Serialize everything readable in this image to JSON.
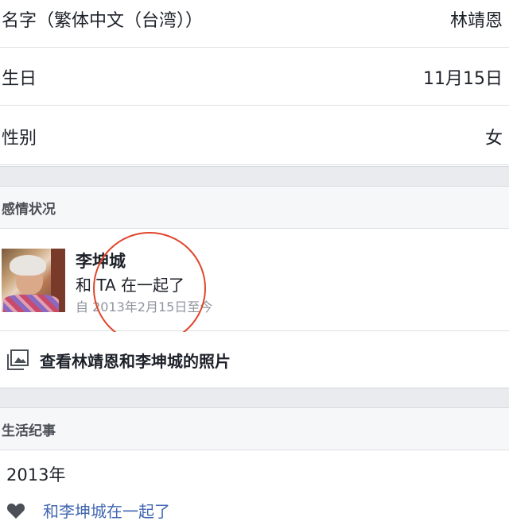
{
  "profile": {
    "rows": [
      {
        "label": "名字（繁体中文（台湾））",
        "value": "林靖恩"
      },
      {
        "label": "生日",
        "value": "11月15日"
      },
      {
        "label": "性别",
        "value": "女"
      }
    ]
  },
  "relationship": {
    "section_title": "感情状况",
    "partner_name": "李坤城",
    "status": "和 TA 在一起了",
    "since": "自 2013年2月15日至今",
    "photos_link": "查看林靖恩和李坤城的照片"
  },
  "life_events": {
    "section_title": "生活纪事",
    "year": "2013年",
    "event": "和李坤城在一起了"
  },
  "colors": {
    "accent_link": "#4267b2",
    "annotation_circle": "#e0452c"
  },
  "icons": [
    "photo-album-icon",
    "heart-icon"
  ]
}
